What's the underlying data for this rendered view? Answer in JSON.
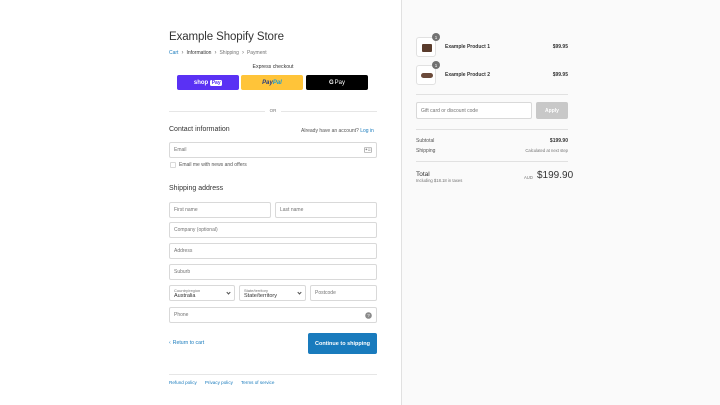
{
  "store": {
    "title": "Example Shopify Store"
  },
  "breadcrumb": [
    {
      "label": "Cart"
    },
    {
      "label": "Information"
    },
    {
      "label": "Shipping"
    },
    {
      "label": "Payment"
    }
  ],
  "express": {
    "label": "Express checkout",
    "shop_pay": {
      "shop": "shop",
      "pay": "Pay"
    },
    "paypal": {
      "pay": "Pay",
      "pal": "Pal"
    },
    "gpay": {
      "g": "G",
      "pay": "Pay"
    },
    "or": "OR"
  },
  "contact": {
    "heading": "Contact information",
    "account_prompt": "Already have an account?",
    "login_label": "Log in",
    "email_placeholder": "Email",
    "newsletter_label": "Email me with news and offers"
  },
  "shipping_address": {
    "heading": "Shipping address",
    "first_name": "First name",
    "last_name": "Last name",
    "company": "Company (optional)",
    "address": "Address",
    "suburb": "Suburb",
    "country_label": "Country/region",
    "country_value": "Australia",
    "state_label": "State/territory",
    "state_value": "State/territory",
    "postcode": "Postcode",
    "phone": "Phone"
  },
  "actions": {
    "return_label": "Return to cart",
    "continue_label": "Continue to shipping"
  },
  "footer": {
    "links": [
      "Refund policy",
      "Privacy policy",
      "Terms of service"
    ]
  },
  "order": {
    "products": [
      {
        "name": "Example Product 1",
        "price": "$99.95",
        "qty": "1"
      },
      {
        "name": "Example Product 2",
        "price": "$99.95",
        "qty": "1"
      }
    ],
    "discount_placeholder": "Gift card or discount code",
    "apply_label": "Apply",
    "subtotal_label": "Subtotal",
    "subtotal_value": "$199.90",
    "shipping_label": "Shipping",
    "shipping_value": "Calculated at next step",
    "total_label": "Total",
    "tax_note": "Including $18.18 in taxes",
    "currency": "AUD",
    "total_value": "$199.90"
  },
  "colors": {
    "link": "#197bbd",
    "primary_button": "#197bbd",
    "shop_pay": "#5a31f4",
    "paypal": "#ffc439",
    "gpay": "#000000"
  }
}
